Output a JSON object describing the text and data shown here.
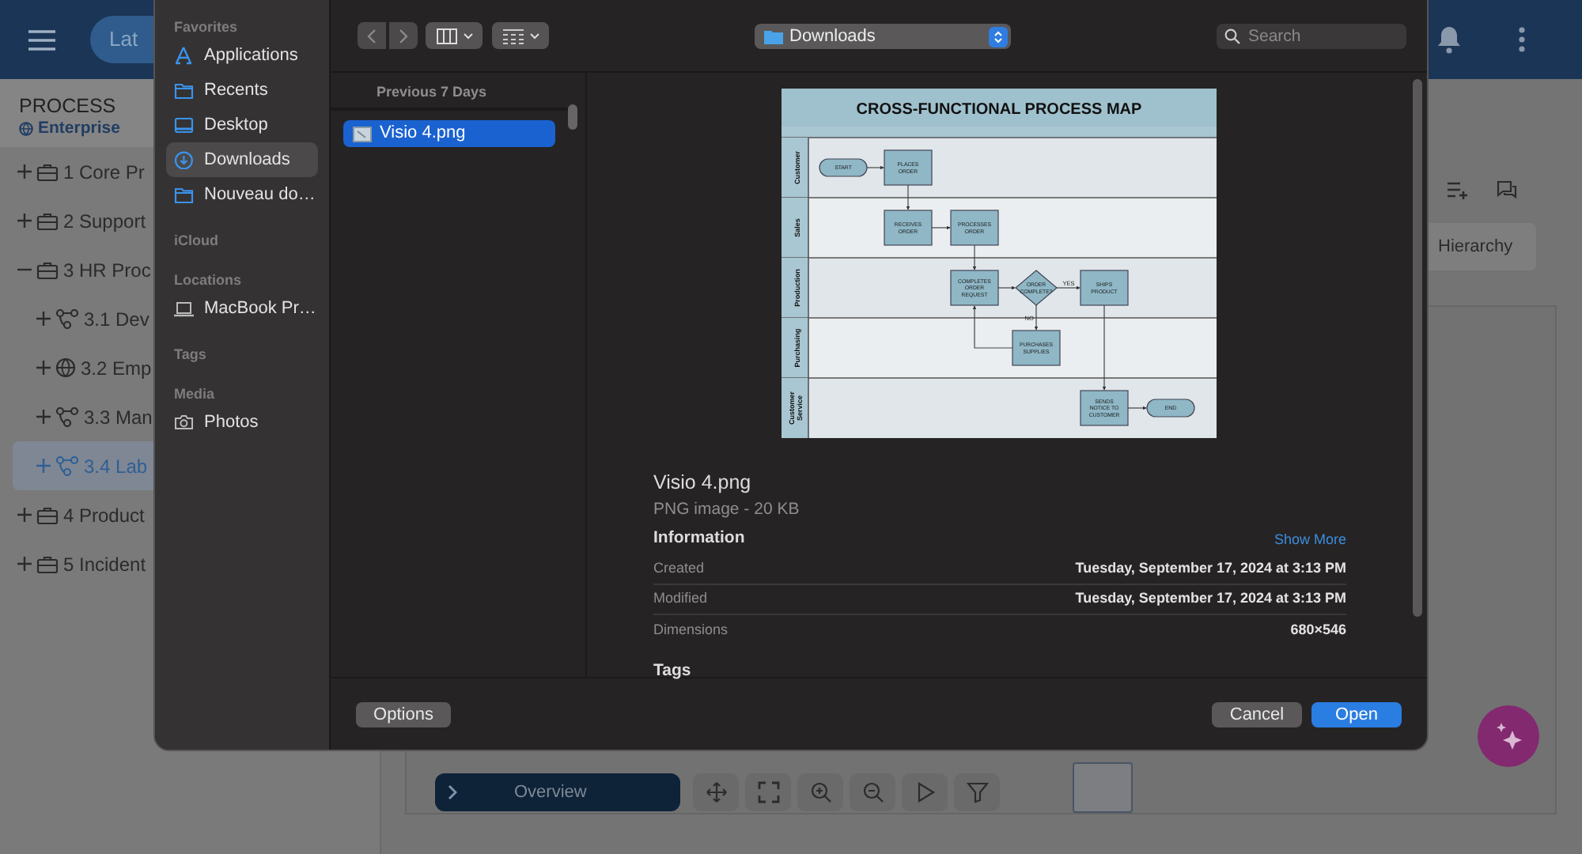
{
  "app": {
    "header": {
      "pill": "Lat"
    },
    "sidebar": {
      "title": "PROCESS",
      "subtitle": "Enterprise",
      "tree": [
        {
          "label": "1 Core Pr",
          "kind": "briefcase",
          "expanded": false,
          "selected": false
        },
        {
          "label": "2 Support",
          "kind": "briefcase",
          "expanded": false,
          "selected": false
        },
        {
          "label": "3 HR Proc",
          "kind": "briefcase",
          "expanded": true,
          "selected": false,
          "children": [
            {
              "label": "3.1 Dev",
              "kind": "hierarchy",
              "expanded": false,
              "selected": false
            },
            {
              "label": "3.2 Emp",
              "kind": "globe",
              "expanded": false,
              "selected": false
            },
            {
              "label": "3.3 Man",
              "kind": "hierarchy",
              "expanded": false,
              "selected": false
            },
            {
              "label": "3.4 Lab",
              "kind": "hierarchy",
              "expanded": false,
              "selected": true
            }
          ]
        },
        {
          "label": "4 Product",
          "kind": "briefcase",
          "expanded": false,
          "selected": false
        },
        {
          "label": "5 Incident",
          "kind": "briefcase",
          "expanded": false,
          "selected": false
        }
      ]
    },
    "hierarchy_button": "Hierarchy",
    "canvas_toolbar": {
      "overview": "Overview"
    }
  },
  "dialog": {
    "sidebar": [
      {
        "heading": "Favorites",
        "items": [
          {
            "label": "Applications",
            "kind": "apps",
            "selected": false
          },
          {
            "label": "Recents",
            "kind": "folder",
            "selected": false
          },
          {
            "label": "Desktop",
            "kind": "desktop",
            "selected": false
          },
          {
            "label": "Downloads",
            "kind": "download",
            "selected": true
          },
          {
            "label": "Nouveau do…",
            "kind": "folder",
            "selected": false
          }
        ]
      },
      {
        "heading": "iCloud"
      },
      {
        "heading": "Locations",
        "items": [
          {
            "label": "MacBook Pr…",
            "kind": "laptop",
            "selected": false
          }
        ]
      },
      {
        "heading": "Tags"
      },
      {
        "heading": "Media",
        "items": [
          {
            "label": "Photos",
            "kind": "camera",
            "selected": false
          }
        ]
      }
    ],
    "location": "Downloads",
    "search": {
      "placeholder": "Search"
    },
    "files": {
      "heading": "Previous 7 Days",
      "items": [
        {
          "name": "Visio 4.png",
          "selected": true
        }
      ]
    },
    "preview": {
      "image": {
        "title": "CROSS-FUNCTIONAL PROCESS MAP",
        "lanes": [
          "Customer",
          "Sales",
          "Production",
          "Purchasing",
          "Customer Service"
        ],
        "nodes": [
          {
            "kind": "terminal",
            "label": "START"
          },
          {
            "kind": "process",
            "label": "PLACES ORDER"
          },
          {
            "kind": "process",
            "label": "RECEIVES ORDER"
          },
          {
            "kind": "process",
            "label": "PROCESSES ORDER"
          },
          {
            "kind": "process",
            "label": "COMPLETES ORDER REQUEST"
          },
          {
            "kind": "decision",
            "label": "ORDER COMPLETE?"
          },
          {
            "kind": "process",
            "label": "SHIPS PRODUCT"
          },
          {
            "kind": "process",
            "label": "PURCHASES SUPPLIES"
          },
          {
            "kind": "process",
            "label": "SENDS NOTICE TO CUSTOMER"
          },
          {
            "kind": "terminal",
            "label": "END"
          }
        ],
        "edge_labels": [
          "YES",
          "NO"
        ]
      },
      "name": "Visio 4.png",
      "kind": "PNG image - 20 KB",
      "info_heading": "Information",
      "show_more": "Show More",
      "info": [
        {
          "label": "Created",
          "value": "Tuesday, September 17, 2024 at 3:13 PM"
        },
        {
          "label": "Modified",
          "value": "Tuesday, September 17, 2024 at 3:13 PM"
        },
        {
          "label": "Dimensions",
          "value": "680×546"
        }
      ],
      "tags_heading": "Tags"
    },
    "buttons": {
      "options": "Options",
      "cancel": "Cancel",
      "open": "Open"
    }
  }
}
